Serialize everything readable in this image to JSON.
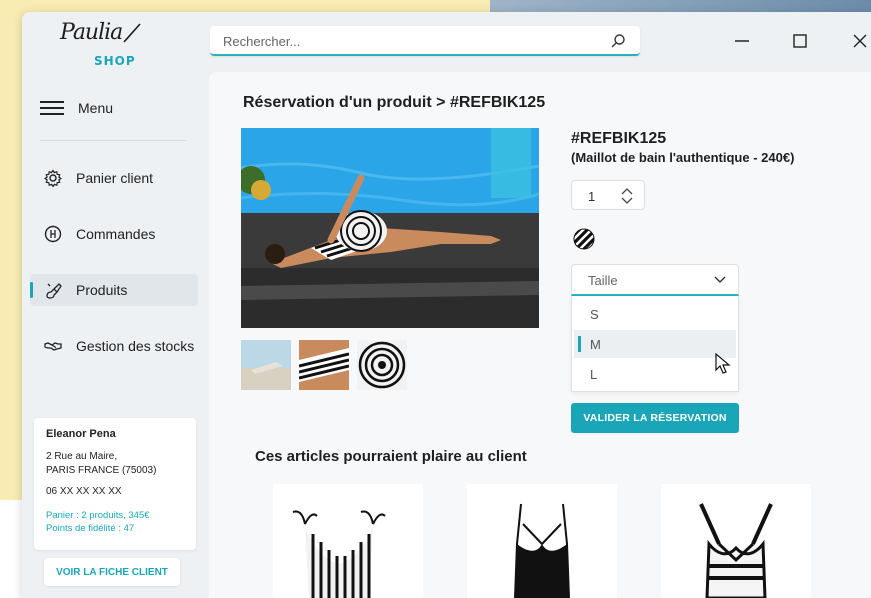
{
  "app": {
    "logo_script": "Paulia",
    "logo_shop": "SHOP"
  },
  "search": {
    "placeholder": "Rechercher..."
  },
  "window_controls": {
    "minimize": "—",
    "maximize": "☐",
    "close": "✕"
  },
  "sidebar": {
    "menu_label": "Menu",
    "items": [
      {
        "label": "Panier client",
        "icon": "gear-icon",
        "active": false
      },
      {
        "label": "Commandes",
        "icon": "coin-icon",
        "active": false
      },
      {
        "label": "Produits",
        "icon": "paintbrush-icon",
        "active": true
      },
      {
        "label": "Gestion des stocks",
        "icon": "handshake-icon",
        "active": false
      }
    ]
  },
  "client": {
    "name": "Eleanor Pena",
    "address_line1": "2 Rue au Maire,",
    "address_line2": "PARIS FRANCE (75003)",
    "phone": "06 XX XX XX XX",
    "cart": "Panier : 2 produits, 345€",
    "loyalty": "Points de fidélité : 47",
    "button_label": "VOIR LA FICHE CLIENT"
  },
  "product": {
    "page_title": "Réservation d'un produit > #REFBIK125",
    "ref": "#REFBIK125",
    "description": "(Maillot de bain l'authentique - 240€)",
    "quantity": "1",
    "size_placeholder": "Taille",
    "sizes": [
      "S",
      "M",
      "L"
    ],
    "hovered_size": "M",
    "validate_label": "VALIDER LA RÉSERVATION"
  },
  "suggestions": {
    "title": "Ces articles pourraient plaire au client"
  },
  "colors": {
    "accent": "#1aa5b8",
    "background_yellow": "#f8ecb2",
    "sidebar_bg": "#eef1f4",
    "main_bg": "#f7f8f9"
  }
}
